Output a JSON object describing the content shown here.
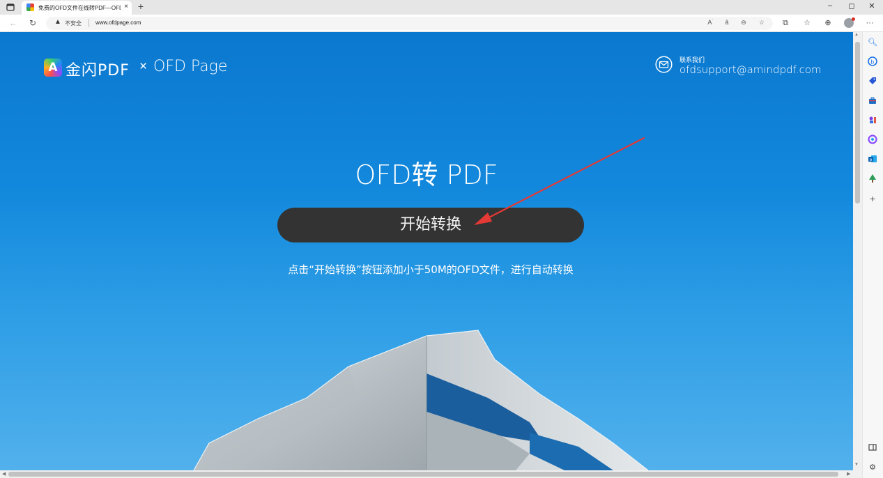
{
  "browser": {
    "tab": {
      "title": "免费的OFD文件在线转PDF—OFD",
      "close_glyph": "×"
    },
    "new_tab_glyph": "+",
    "window_controls": {
      "minimize": "–",
      "restore": "◻",
      "close": "✕"
    },
    "address": {
      "security_label": "不安全",
      "url": "www.ofdpage.com"
    }
  },
  "page": {
    "brand": {
      "logo_letter": "A",
      "name": "金闪PDF",
      "separator": "×",
      "partner": "OFD Page"
    },
    "contact": {
      "label": "联系我们",
      "email": "ofdsupport@amindpdf.com"
    },
    "headline": "OFD转 PDF",
    "cta_label": "开始转换",
    "hint": "点击“开始转换”按钮添加小于50M的OFD文件，进行自动转换"
  },
  "colors": {
    "sky_top": "#0b78cf",
    "sky_bottom": "#52b1ec",
    "cta_background": "#333333",
    "annotation_arrow": "#e53935"
  },
  "icons": {
    "toolbar": [
      "back-icon",
      "refresh-icon",
      "read-aloud-icon",
      "translate-icon",
      "zoom-icon",
      "favorite-add-icon",
      "extensions-icon",
      "favorites-icon",
      "collections-icon",
      "profile-icon",
      "more-icon"
    ],
    "sidebar": [
      "search-icon",
      "bing-chat-icon",
      "shopping-tag-icon",
      "toolbox-icon",
      "games-icon",
      "office-icon",
      "outlook-icon",
      "tree-icon",
      "add-icon",
      "split-screen-icon",
      "settings-icon"
    ]
  }
}
